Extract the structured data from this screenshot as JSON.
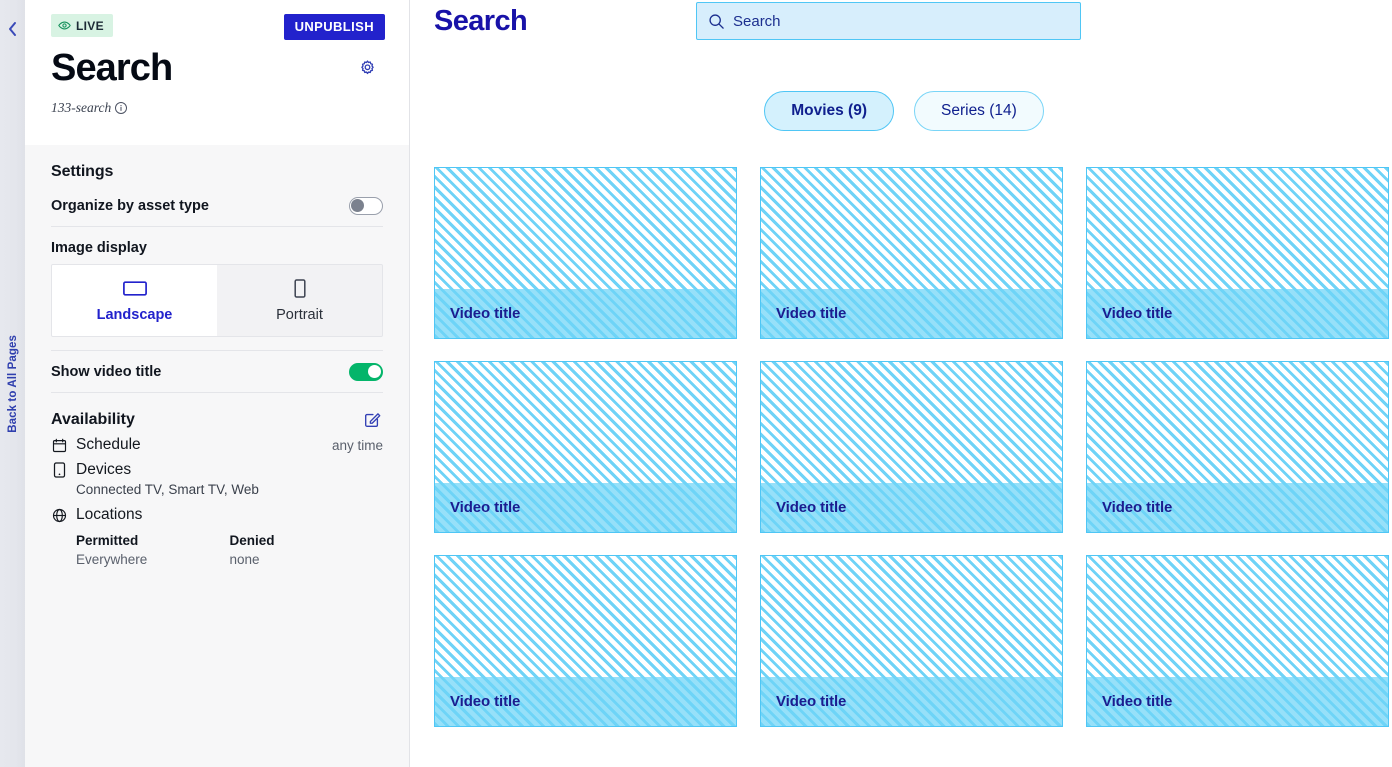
{
  "rail": {
    "back_label": "Back to All Pages",
    "collapse_icon": "chevron-left-icon"
  },
  "sidebar": {
    "status_badge": {
      "label": "LIVE",
      "icon": "eye-icon",
      "bg": "#d8f3e3",
      "fg": "#1d2b36"
    },
    "unpublish_label": "UNPUBLISH",
    "unpublish_bg": "#2222cc",
    "page_title": "Search",
    "gear_icon": "gear-icon",
    "slug": "133-search",
    "info_icon": "info-circle-icon",
    "settings": {
      "title": "Settings",
      "organize_label": "Organize by asset type",
      "organize_state": "off",
      "image_display_label": "Image display",
      "image_display_options": [
        {
          "label": "Landscape",
          "icon": "landscape-rect-icon",
          "selected": true
        },
        {
          "label": "Portrait",
          "icon": "portrait-rect-icon",
          "selected": false
        }
      ],
      "show_video_title_label": "Show video title",
      "show_video_title_state": "on",
      "toggle_on_color": "#04b56a"
    },
    "availability": {
      "title": "Availability",
      "edit_icon": "edit-pencil-icon",
      "schedule_label": "Schedule",
      "schedule_icon": "calendar-icon",
      "schedule_value": "any time",
      "devices_label": "Devices",
      "devices_icon": "device-icon",
      "devices_value": "Connected TV, Smart TV, Web",
      "locations_label": "Locations",
      "locations_icon": "globe-icon",
      "permitted_header": "Permitted",
      "permitted_value": "Everywhere",
      "denied_header": "Denied",
      "denied_value": "none"
    }
  },
  "preview": {
    "title": "Search",
    "title_color": "#1812a8",
    "search": {
      "placeholder": "Search",
      "value": "",
      "icon": "search-icon",
      "bg": "#d7eefc",
      "border": "#4fc6f5"
    },
    "tabs": [
      {
        "label": "Movies (9)",
        "active": true
      },
      {
        "label": "Series (14)",
        "active": false
      }
    ],
    "cards": [
      {
        "title": "Video title"
      },
      {
        "title": "Video title"
      },
      {
        "title": "Video title"
      },
      {
        "title": "Video title"
      },
      {
        "title": "Video title"
      },
      {
        "title": "Video title"
      },
      {
        "title": "Video title"
      },
      {
        "title": "Video title"
      },
      {
        "title": "Video title"
      }
    ]
  }
}
